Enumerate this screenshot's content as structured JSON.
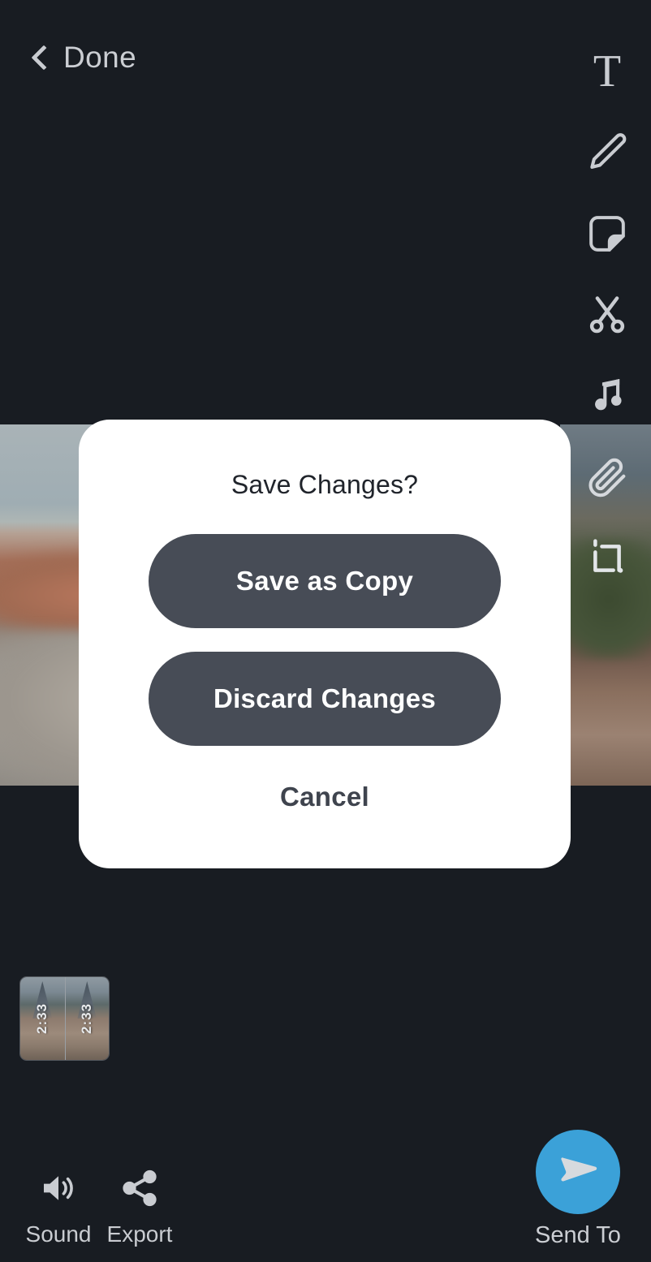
{
  "theme": {
    "background": "#181c22",
    "dialog_background": "#ffffff",
    "button_fill": "#474c56",
    "accent_blue": "#3ba1d8",
    "icon_color": "#c9ccd1"
  },
  "topbar": {
    "done_label": "Done",
    "back_icon": "chevron-left-icon"
  },
  "toolrail": {
    "items": [
      {
        "icon": "text-icon",
        "label": "T"
      },
      {
        "icon": "pencil-icon",
        "label": "Draw"
      },
      {
        "icon": "sticker-icon",
        "label": "Sticker"
      },
      {
        "icon": "scissors-icon",
        "label": "Trim"
      },
      {
        "icon": "music-note-icon",
        "label": "Music"
      },
      {
        "icon": "paperclip-icon",
        "label": "Attach"
      },
      {
        "icon": "crop-icon",
        "label": "Crop"
      }
    ]
  },
  "dialog": {
    "title": "Save Changes?",
    "save_as_copy_label": "Save as Copy",
    "discard_changes_label": "Discard Changes",
    "cancel_label": "Cancel"
  },
  "timeline": {
    "clips": [
      {
        "duration": "2:33"
      },
      {
        "duration": "2:33"
      }
    ]
  },
  "bottombar": {
    "sound_label": "Sound",
    "sound_icon": "speaker-icon",
    "export_label": "Export",
    "export_icon": "share-icon",
    "send_to_label": "Send To",
    "send_to_icon": "send-arrow-icon"
  }
}
